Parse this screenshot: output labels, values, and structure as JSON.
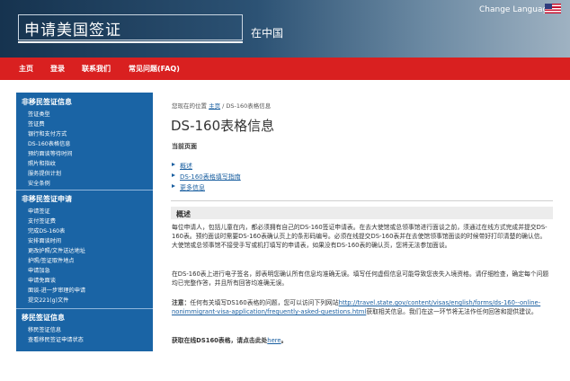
{
  "header": {
    "site_title": "申请美国签证",
    "country": "在中国",
    "change_language": "Change Language"
  },
  "nav": {
    "items": [
      "主页",
      "登录",
      "联系我们",
      "常见问题(FAQ)"
    ]
  },
  "sidebar": {
    "sections": [
      {
        "heading": "非移民签证信息",
        "items": [
          "签证类型",
          "签证费",
          "银行和支付方式",
          "DS-160表格信息",
          "预约面谈等待时间",
          "照片和指纹",
          "服务提供计划",
          "安全条例"
        ]
      },
      {
        "heading": "非移民签证申请",
        "items": [
          "申请签证",
          "支付签证费",
          "完成DS-160表",
          "安排面谈时间",
          "更改护照/文件送达地址",
          "护照/签证取件地点",
          "申请加急",
          "申请免面谈",
          "面谈-进一步审理的申请",
          "提交221(g)文件"
        ]
      },
      {
        "heading": "移民签证信息",
        "items": [
          "移民签证信息",
          "查看移民签证申请状态"
        ]
      }
    ]
  },
  "main": {
    "breadcrumb_prefix": "您现在的位置 ",
    "breadcrumb_link": "主页",
    "breadcrumb_suffix": " / DS-160表格信息",
    "page_title": "DS-160表格信息",
    "current_page_label": "当前页面",
    "toc": [
      "概述",
      "DS-160表格填写指南",
      "更多信息"
    ],
    "section_title": "概述",
    "para1": "每位申请人，包括儿童在内，都必须拥有自己的DS-160签证申请表。在去大使馆或总领事馆进行面谈之前，须通过在线方式完成并提交DS-160表。预约面谈时需要DS-160表确认页上的条形码编号。必须在线提交DS-160表并在去使馆领事馆面谈的时候带好打印清楚的确认信。大使馆或总领事馆不接受手写或机打填写的申请表，如果没有DS-160表的确认页，您将无法参加面谈。",
    "para2": "在DS-160表上进行电子签名，即表明您确认所有信息均准确无误。填写任何虚假信息可能导致您丧失入境资格。请仔细检查，确定每个问题均已完整作答，并且所有回答均准确无误。",
    "note_label": "注意：",
    "note_text": "任何有关填写DS160表格的问题，您可以访问下列网站",
    "note_url": "http://travel.state.gov/content/visas/english/forms/ds-160--online-nonimmigrant-visa-application/frequently-asked-questions.html",
    "note_tail": "获取相关信息。我们在这一环节将无法作任何回答和提供建议。",
    "get_form_label": "获取在线DS160表格，请点击此处",
    "get_form_link": "here",
    "get_form_end": "。"
  }
}
